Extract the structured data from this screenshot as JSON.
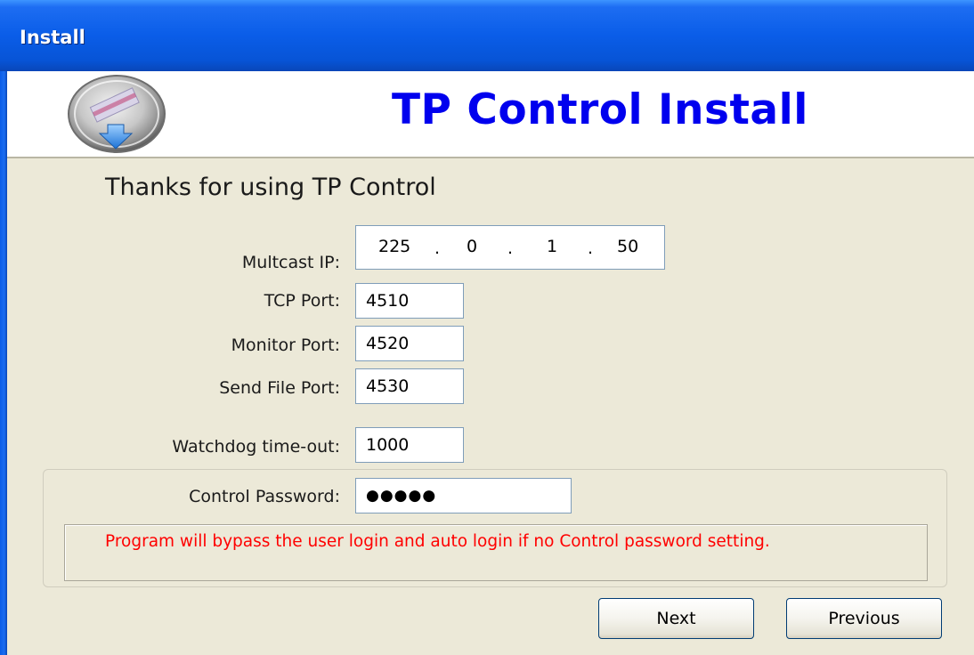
{
  "window": {
    "title": "Install"
  },
  "header": {
    "title": "TP Control Install",
    "logo_icon": "install-disk-icon"
  },
  "intro": "Thanks for using TP Control",
  "fields": {
    "multicast_ip": {
      "label": "Multcast IP:",
      "octets": [
        "225",
        "0",
        "1",
        "50"
      ],
      "separator": "."
    },
    "tcp_port": {
      "label": "TCP Port:",
      "value": "4510"
    },
    "monitor_port": {
      "label": "Monitor Port:",
      "value": "4520"
    },
    "send_file_port": {
      "label": "Send File Port:",
      "value": "4530"
    },
    "watchdog_timeout": {
      "label": "Watchdog time-out:",
      "value": "1000"
    },
    "control_password": {
      "label": "Control Password:",
      "value": "●●●●●"
    }
  },
  "note": "Program will bypass the user login and auto login if no Control password setting.",
  "buttons": {
    "next": "Next",
    "previous": "Previous"
  },
  "colors": {
    "title_bar": "#0a5de8",
    "header_title": "#0000ee",
    "note_text": "#ff0000",
    "dialog_bg": "#ece9d8"
  }
}
